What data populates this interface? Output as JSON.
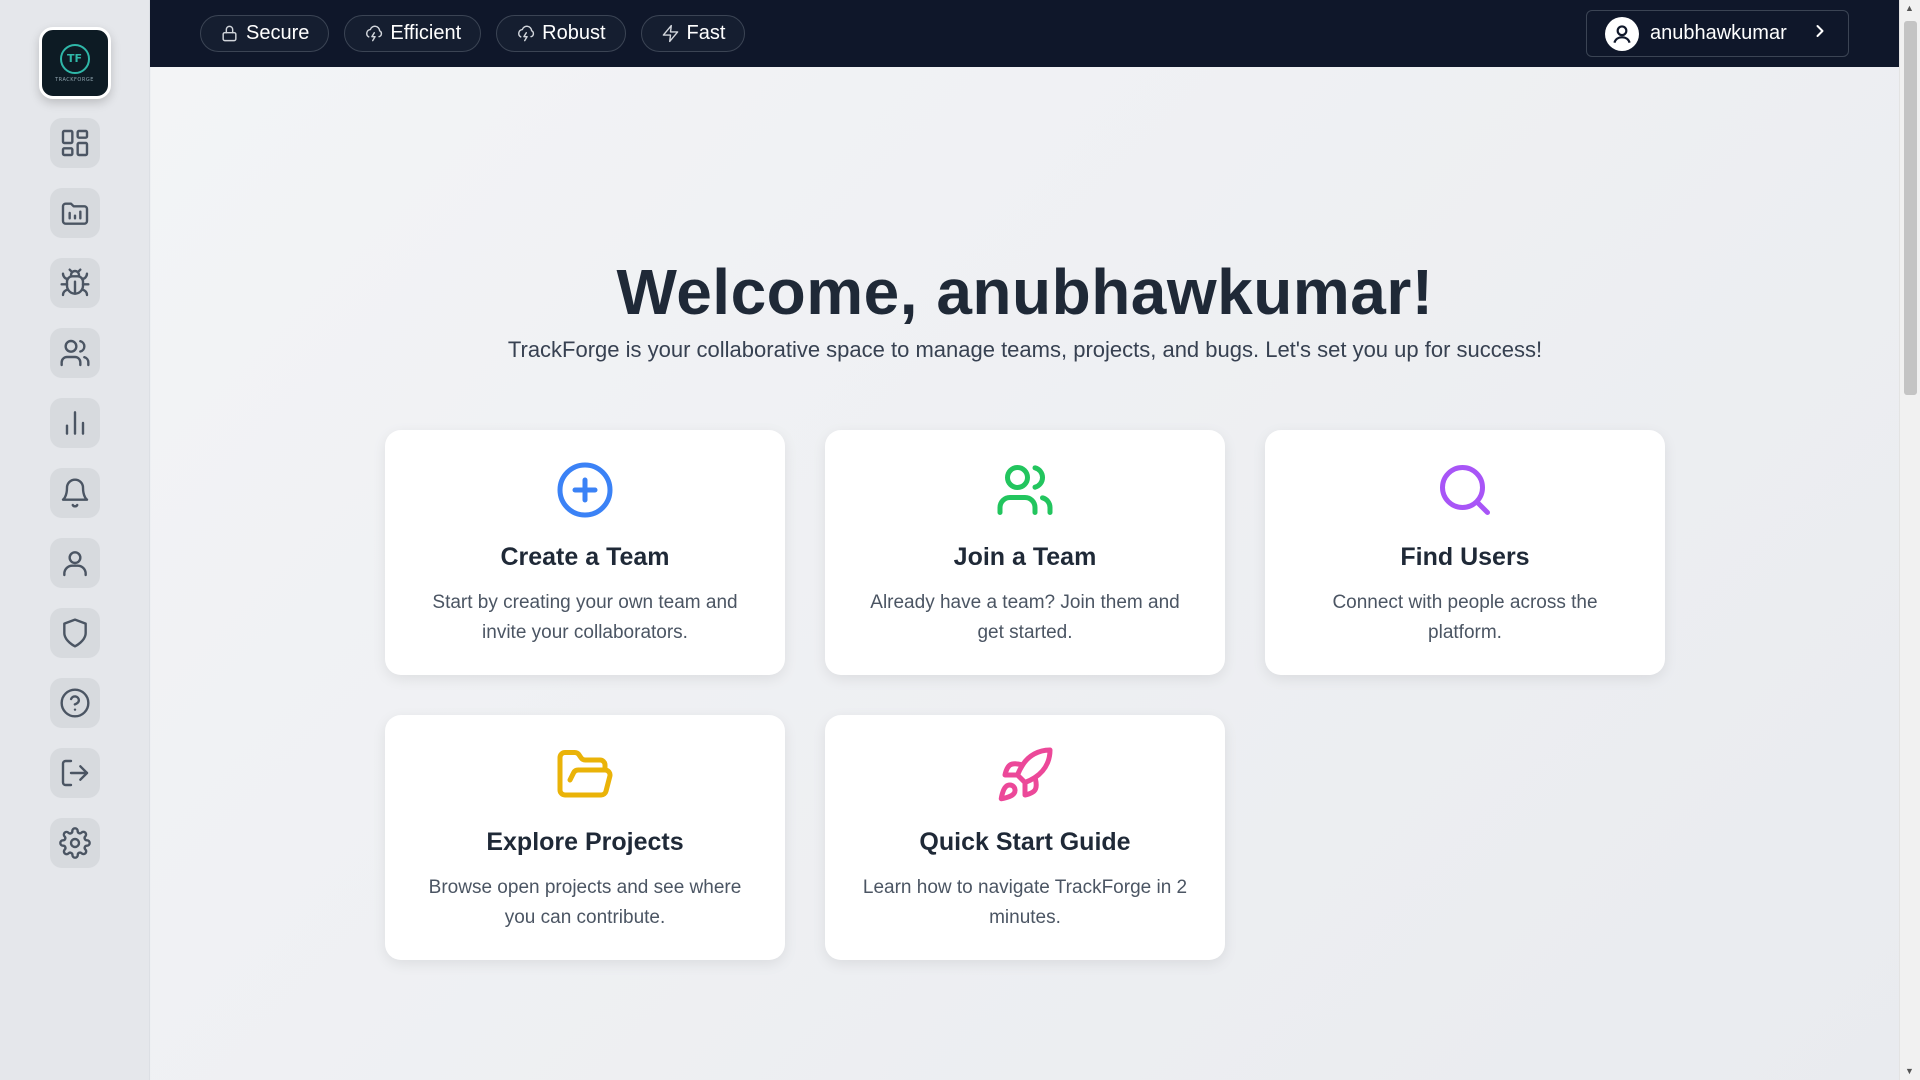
{
  "app": {
    "logo_text": "TRACKFORGE",
    "logo_mark": "TF"
  },
  "sidebar": {
    "items": [
      {
        "icon": "dashboard-icon"
      },
      {
        "icon": "projects-folder-icon"
      },
      {
        "icon": "bug-icon"
      },
      {
        "icon": "users-icon"
      },
      {
        "icon": "analytics-icon"
      },
      {
        "icon": "bell-icon"
      },
      {
        "icon": "user-icon"
      },
      {
        "icon": "shield-icon"
      },
      {
        "icon": "help-icon"
      },
      {
        "icon": "logout-icon"
      },
      {
        "icon": "gear-icon"
      }
    ]
  },
  "header": {
    "pills": [
      {
        "label": "Secure",
        "icon": "lock-icon"
      },
      {
        "label": "Efficient",
        "icon": "cloud-lightning-icon"
      },
      {
        "label": "Robust",
        "icon": "cloud-lightning-icon"
      },
      {
        "label": "Fast",
        "icon": "zap-icon"
      }
    ],
    "username": "anubhawkumar"
  },
  "main": {
    "welcome": "Welcome, anubhawkumar!",
    "subtitle": "TrackForge is your collaborative space to manage teams, projects, and bugs. Let's set you up for success!",
    "cards": [
      {
        "title": "Create a Team",
        "description": "Start by creating your own team and invite your collaborators.",
        "icon": "plus-circle-icon",
        "color": "#3b82f6"
      },
      {
        "title": "Join a Team",
        "description": "Already have a team? Join them and get started.",
        "icon": "users-icon",
        "color": "#22c55e"
      },
      {
        "title": "Find Users",
        "description": "Connect with people across the platform.",
        "icon": "search-icon",
        "color": "#a855f7"
      },
      {
        "title": "Explore Projects",
        "description": "Browse open projects and see where you can contribute.",
        "icon": "folder-open-icon",
        "color": "#eab308"
      },
      {
        "title": "Quick Start Guide",
        "description": "Learn how to navigate TrackForge in 2 minutes.",
        "icon": "rocket-icon",
        "color": "#ec4899"
      }
    ]
  }
}
